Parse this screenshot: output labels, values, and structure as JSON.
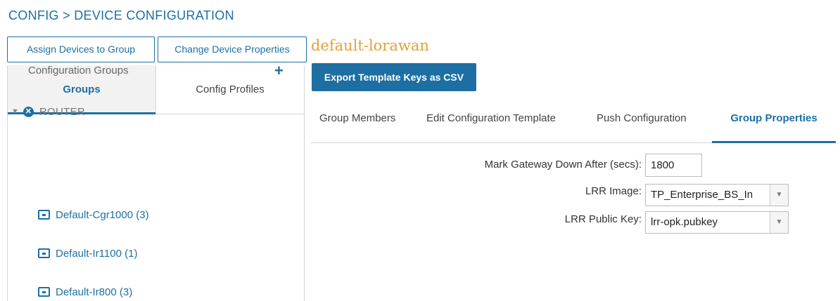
{
  "breadcrumb": "CONFIG > DEVICE CONFIGURATION",
  "toolbar": {
    "assign_label": "Assign Devices to Group",
    "change_label": "Change Device Properties"
  },
  "left_tabs": [
    {
      "label": "Groups",
      "active": true
    },
    {
      "label": "Config Profiles",
      "active": false
    }
  ],
  "config_groups_label": "Configuration Groups",
  "add_symbol": "+",
  "tree": {
    "caret": "▼",
    "router_icon": "router-icon",
    "router_icon_glyph": "✕",
    "router_label": "ROUTER",
    "groups": [
      {
        "label": "Default-Cgr1000 (3)"
      },
      {
        "label": "Default-Ir1100 (1)"
      },
      {
        "label": "Default-Ir800 (3)"
      }
    ]
  },
  "profile_title": "default-lorawan",
  "export_label": "Export Template Keys as CSV",
  "right_tabs": [
    {
      "label": "Group Members",
      "active": false
    },
    {
      "label": "Edit Configuration Template",
      "active": false
    },
    {
      "label": "Push Configuration",
      "active": false
    },
    {
      "label": "Group Properties",
      "active": true
    }
  ],
  "form": {
    "gateway_down_label": "Mark Gateway Down After (secs):",
    "gateway_down_value": "1800",
    "lrr_image_label": "LRR Image:",
    "lrr_image_value": "TP_Enterprise_BS_In",
    "lrr_key_label": "LRR Public Key:",
    "lrr_key_value": "lrr-opk.pubkey"
  },
  "colors": {
    "accent": "#1d6fa3",
    "title": "#e3a036"
  }
}
